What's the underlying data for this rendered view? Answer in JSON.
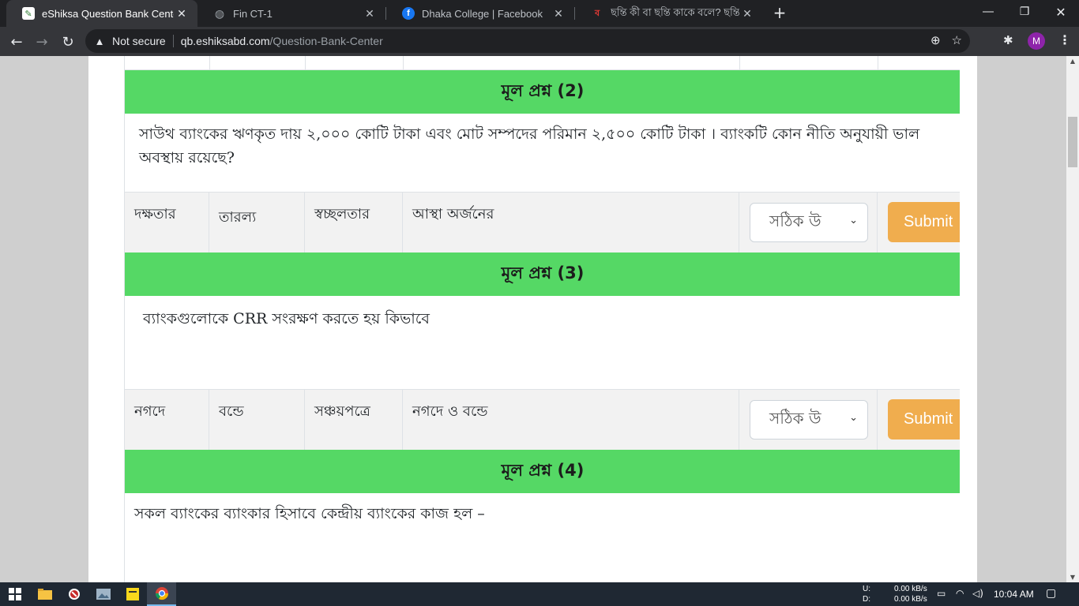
{
  "browser": {
    "tabs": [
      {
        "title": "eShiksa Question Bank Center",
        "active": true,
        "favicon": "eshiksa-icon"
      },
      {
        "title": "Fin CT-1",
        "active": false,
        "favicon": "globe-icon"
      },
      {
        "title": "Dhaka College | Facebook",
        "active": false,
        "favicon": "facebook-icon"
      },
      {
        "title": "ছন্তি কী বা ছন্তি কাকে বলে? ছন্তির",
        "active": false,
        "favicon": "site-icon"
      }
    ],
    "security_label": "Not secure",
    "url_host": "qb.eshiksabd.com",
    "url_path": "/Question-Bank-Center",
    "profile_initial": "M"
  },
  "questions": [
    {
      "heading": "মূল প্রশ্ন (2)",
      "text": "সাউথ ব্যাংকের ঋণকৃত দায় ২,০০০ কোটি টাকা এবং মোট সম্পদের পরিমান ২,৫০০ কোটি টাকা । ব্যাংকটি কোন নীতি অনুযায়ী ভাল অবস্থায় রয়েছে?",
      "options": [
        "দক্ষতার",
        "তারল্য",
        "স্বচ্ছলতার",
        "আস্থা অর্জনের"
      ],
      "select_value": "সঠিক উ",
      "submit_label": "Submit"
    },
    {
      "heading": "মূল প্রশ্ন (3)",
      "text": "ব্যাংকগুলোকে CRR সংরক্ষণ করতে হয় কিভাবে",
      "options": [
        "নগদে",
        "বন্ডে",
        "সঞ্চয়পত্রে",
        "নগদে ও বন্ডে"
      ],
      "select_value": "সঠিক উ",
      "submit_label": "Submit"
    },
    {
      "heading": "মূল প্রশ্ন (4)",
      "text": "সকল ব্যাংকের ব্যাংকার হিসাবে কেন্দ্রীয় ব্যাংকের কাজ হল –"
    }
  ],
  "taskbar": {
    "net_up_label": "U:",
    "net_down_label": "D:",
    "net_up_value": "0.00 kB/s",
    "net_down_value": "0.00 kB/s",
    "time": "10:04 AM"
  }
}
